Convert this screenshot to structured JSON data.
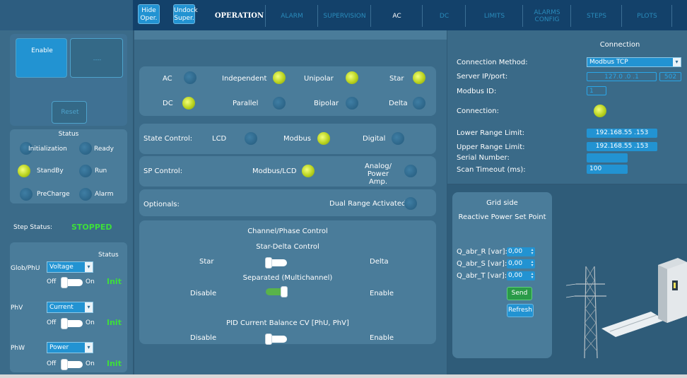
{
  "nav": {
    "hide_oper": "Hide Oper.",
    "undock_super": "Undock Super.",
    "tabs": [
      "OPERATION",
      "ALARM",
      "SUPERVISION",
      "AC",
      "DC",
      "LIMITS",
      "ALARMS CONFIG",
      "STEPS",
      "PLOTS"
    ]
  },
  "left": {
    "enable_label": "Enable",
    "blank_label": "----",
    "reset_label": "Reset",
    "status_title": "Status",
    "states": [
      "Initialization",
      "Ready",
      "StandBy",
      "Run",
      "PreCharge",
      "Alarm"
    ],
    "step_status_label": "Step Status:",
    "step_status_value": "STOPPED",
    "status_header": "Status",
    "glob_phu": "Glob/PhU",
    "phv": "PhV",
    "phw": "PhW",
    "voltage": "Voltage",
    "current": "Current",
    "power": "Power",
    "off": "Off",
    "on": "On",
    "init": "Init"
  },
  "middle": {
    "ac": "AC",
    "dc": "DC",
    "independent": "Independent",
    "parallel": "Parallel",
    "unipolar": "Unipolar",
    "bipolar": "Bipolar",
    "star": "Star",
    "delta": "Delta",
    "state_control": "State Control:",
    "lcd": "LCD",
    "modbus": "Modbus",
    "digital": "Digital",
    "sp_control": "SP Control:",
    "modbus_lcd": "Modbus/LCD",
    "analog_power_amp": "Analog/ Power Amp.",
    "optionals": "Optionals:",
    "dual_range": "Dual Range Activated",
    "channel_phase_control": "Channel/Phase Control",
    "star_delta_control": "Star-Delta Control",
    "star2": "Star",
    "delta2": "Delta",
    "separated": "Separated (Multichannel)",
    "disable": "Disable",
    "enable": "Enable",
    "pid": "PID Current Balance CV [PhU, PhV]",
    "disable2": "Disable",
    "enable2": "Enable"
  },
  "connection": {
    "title": "Connection",
    "method_label": "Connection Method:",
    "method_value": "Modbus TCP",
    "server_label": "Server IP/port:",
    "server_ip": "127.0 .0 .1",
    "server_port": "502",
    "modbus_id_label": "Modbus ID:",
    "modbus_id_value": "1",
    "connection_label": "Connection:",
    "lower_label": "Lower Range Limit:",
    "lower_value": "192.168.55 .153",
    "upper_label": "Upper Range Limit:",
    "upper_value": "192.168.55 .153",
    "serial_label": "Serial Number:",
    "serial_value": "",
    "scan_label": "Scan Timeout (ms):",
    "scan_value": "100"
  },
  "grid": {
    "title": "Grid side",
    "subtitle": "Reactive Power Set Point",
    "q_r_label": "Q_abr_R [var]:",
    "q_s_label": "Q_abr_S [var]:",
    "q_t_label": "Q_abr_T [var]:",
    "q_r_value": "0,00",
    "q_s_value": "0,00",
    "q_t_value": "0,00",
    "send": "Send",
    "refresh": "Refresh"
  },
  "colors": {
    "led_on": "#c8e024",
    "stopped_green": "#3ddf3a",
    "accent_blue": "#2293d2"
  }
}
